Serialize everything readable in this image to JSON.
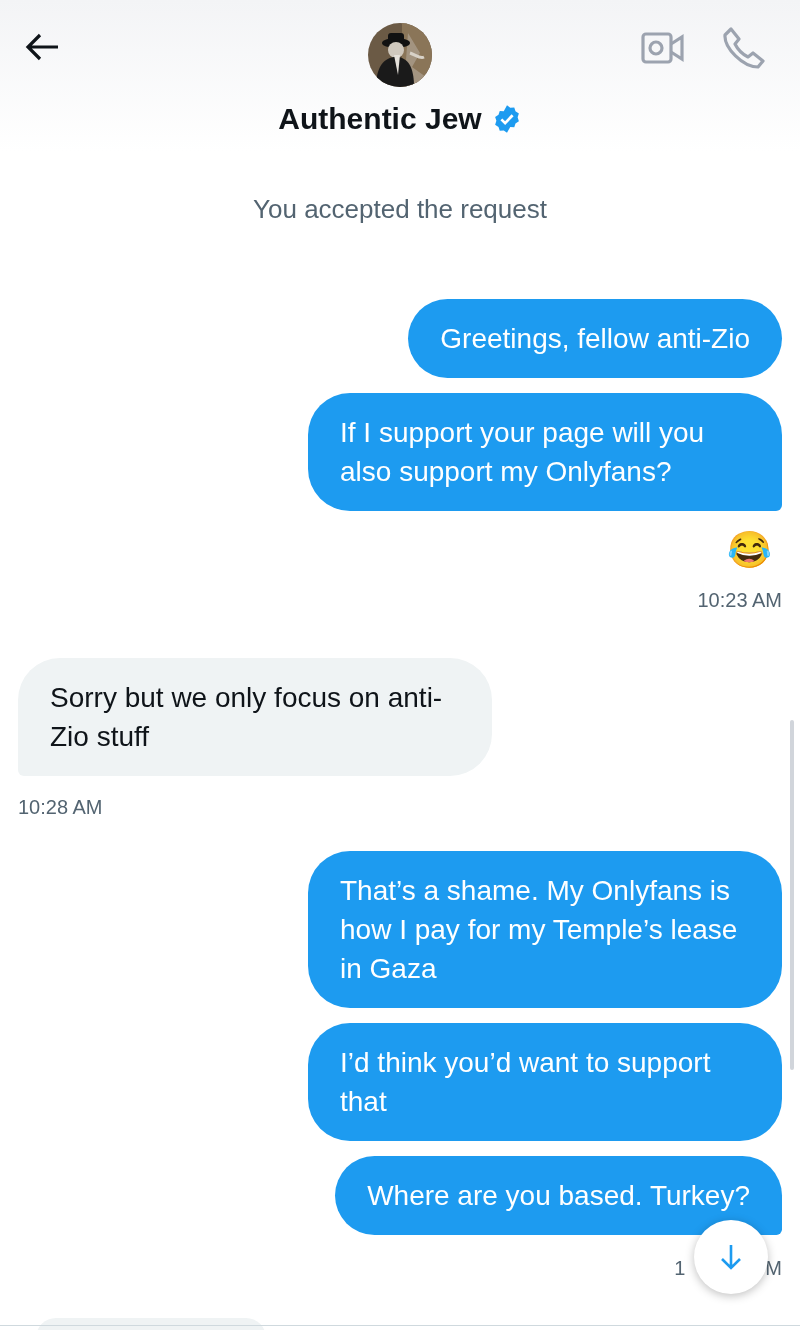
{
  "header": {
    "title": "Authentic Jew",
    "verified": true
  },
  "notice": "You accepted the request",
  "messages": [
    {
      "kind": "text",
      "outgoing": true,
      "text": "Greetings, fellow anti-Zio",
      "tail": false
    },
    {
      "kind": "text",
      "outgoing": true,
      "text": "If I support your page will you also support my Onlyfans?",
      "tail": true
    },
    {
      "kind": "emoji",
      "text": "😂"
    },
    {
      "kind": "timestamp",
      "outgoing": true,
      "text": "10:23 AM"
    },
    {
      "kind": "text",
      "outgoing": false,
      "text": "Sorry but we only focus on anti-Zio stuff",
      "tail": true
    },
    {
      "kind": "timestamp",
      "outgoing": false,
      "text": "10:28 AM"
    },
    {
      "kind": "text",
      "outgoing": true,
      "text": "That’s a shame. My Onlyfans is how I pay for my Temple’s lease in Gaza",
      "tail": false
    },
    {
      "kind": "text",
      "outgoing": true,
      "text": "I’d think you’d want to support that",
      "tail": false
    },
    {
      "kind": "text",
      "outgoing": true,
      "text": "Where are you based. Turkey?",
      "tail": true
    },
    {
      "kind": "covered_timestamp",
      "outgoing": true,
      "parts": [
        "1",
        "M"
      ]
    }
  ]
}
